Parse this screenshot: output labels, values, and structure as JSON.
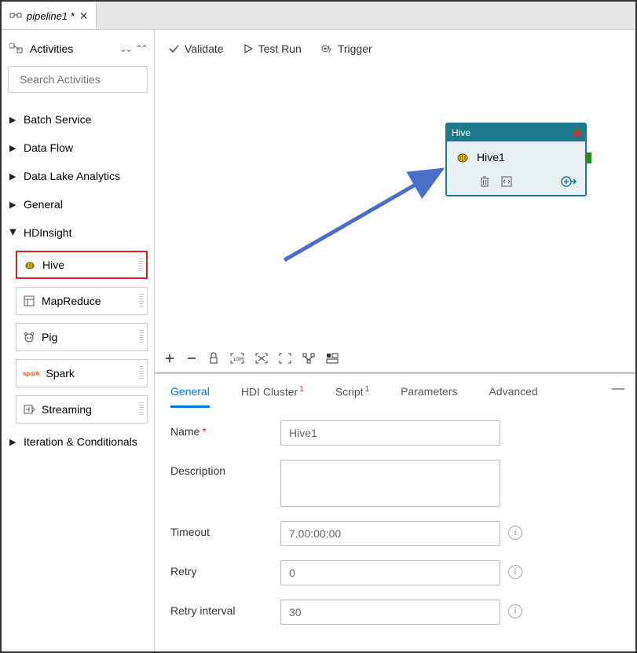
{
  "tab": {
    "title": "pipeline1 *"
  },
  "sidebar": {
    "header": "Activities",
    "searchPlaceholder": "Search Activities",
    "groups": [
      {
        "label": "Batch Service",
        "expanded": false
      },
      {
        "label": "Data Flow",
        "expanded": false
      },
      {
        "label": "Data Lake Analytics",
        "expanded": false
      },
      {
        "label": "General",
        "expanded": false
      },
      {
        "label": "HDInsight",
        "expanded": true,
        "items": [
          {
            "label": "Hive",
            "highlight": true
          },
          {
            "label": "MapReduce"
          },
          {
            "label": "Pig"
          },
          {
            "label": "Spark"
          },
          {
            "label": "Streaming"
          }
        ]
      },
      {
        "label": "Iteration & Conditionals",
        "expanded": false
      }
    ]
  },
  "toolbar": {
    "validate": "Validate",
    "testrun": "Test Run",
    "trigger": "Trigger"
  },
  "node": {
    "type": "Hive",
    "name": "Hive1"
  },
  "panel": {
    "tabs": {
      "general": "General",
      "hdi": "HDI Cluster",
      "hdiErr": "1",
      "script": "Script",
      "scriptErr": "1",
      "params": "Parameters",
      "advanced": "Advanced"
    },
    "form": {
      "nameLabel": "Name",
      "nameValue": "Hive1",
      "descLabel": "Description",
      "descValue": "",
      "timeoutLabel": "Timeout",
      "timeoutValue": "7.00:00:00",
      "retryLabel": "Retry",
      "retryValue": "0",
      "retryIntLabel": "Retry interval",
      "retryIntValue": "30"
    }
  }
}
